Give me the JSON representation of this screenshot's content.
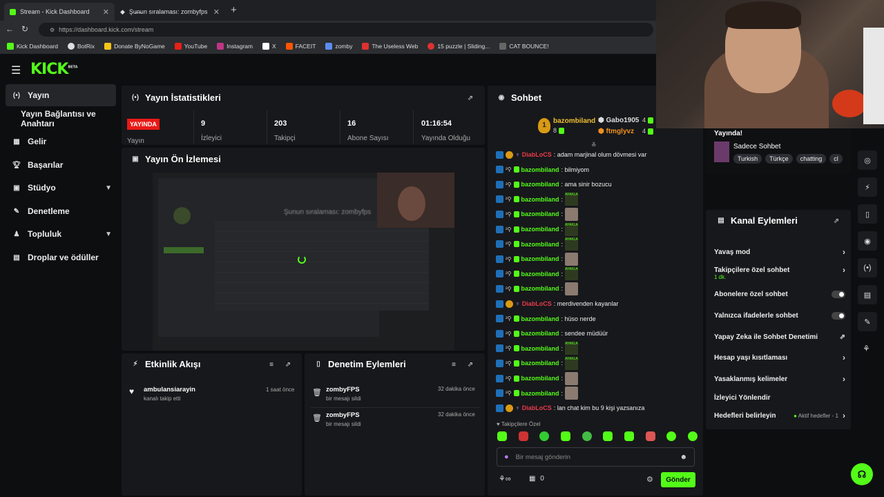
{
  "browser": {
    "tabs": [
      {
        "title": "Stream - Kick Dashboard"
      },
      {
        "title": "Şu̶n̶un sıralaması: zombyfps | Yayı"
      }
    ],
    "url": "https://dashboard.kick.com/stream",
    "bookmarks": [
      "Kick Dashboard",
      "BotRix",
      "Donate ByNoGame",
      "YouTube",
      "Instagram",
      "X",
      "FACEIT",
      "zomby",
      "The Useless Web",
      "15 puzzle | Sliding...",
      "CAT BOUNCE!"
    ]
  },
  "brand": {
    "logo": "KICK",
    "beta": "BETA"
  },
  "sidebar": {
    "items": [
      {
        "label": "Yayın",
        "icon": "broadcast-icon"
      },
      {
        "label": "Yayın Bağlantısı ve Anahtarı"
      },
      {
        "label": "Gelir",
        "icon": "revenue-icon"
      },
      {
        "label": "Başarılar",
        "icon": "trophy-icon"
      },
      {
        "label": "Stüdyo",
        "icon": "studio-icon"
      },
      {
        "label": "Denetleme",
        "icon": "wrench-icon"
      },
      {
        "label": "Topluluk",
        "icon": "community-icon"
      },
      {
        "label": "Droplar ve ödüller",
        "icon": "drops-icon"
      }
    ]
  },
  "stats": {
    "title": "Yayın İstatistikleri",
    "live": "YAYINDA",
    "live_label": "Yayın",
    "items": [
      {
        "value": "9",
        "label": "İzleyici"
      },
      {
        "value": "203",
        "label": "Takipçi"
      },
      {
        "value": "16",
        "label": "Abone Sayısı"
      },
      {
        "value": "01:16:54",
        "label": "Yayında Olduğu"
      }
    ]
  },
  "preview": {
    "title": "Yayın Ön İzlemesi",
    "inner_text": "Şunun sıralaması: zombyfps"
  },
  "activity": {
    "title": "Etkinlik Akışı",
    "items": [
      {
        "user": "ambulansiarayin",
        "action": "kanalı takip etti",
        "time": "1 saat önce"
      }
    ]
  },
  "moderation": {
    "title": "Denetim Eylemleri",
    "items": [
      {
        "user": "zombyFPS",
        "action": "bir mesajı sildi",
        "time": "32 dakika önce"
      },
      {
        "user": "zombyFPS",
        "action": "bir mesajı sildi",
        "time": "32 dakika önce"
      }
    ]
  },
  "chat": {
    "title": "Sohbet",
    "top": [
      {
        "name": "bazombiland",
        "count": "8"
      },
      {
        "name": "Gabo1905",
        "count": "4"
      },
      {
        "name": "ftmglyvz",
        "count": "4"
      }
    ],
    "messages": [
      {
        "user": "DiabLoCS",
        "text": ": adam marjinal olum dövmesi var",
        "red": true
      },
      {
        "user": "bazombiland",
        "text": ": bilmiyom"
      },
      {
        "user": "bazombiland",
        "text": ": ama sinir bozucu"
      },
      {
        "user": "bazombiland",
        "text": ":",
        "emote": "text"
      },
      {
        "user": "bazombiland",
        "text": ":",
        "emote": "img"
      },
      {
        "user": "bazombiland",
        "text": ":",
        "emote": "text"
      },
      {
        "user": "bazombiland",
        "text": ":",
        "emote": "text"
      },
      {
        "user": "bazombiland",
        "text": ":",
        "emote": "img"
      },
      {
        "user": "bazombiland",
        "text": ":",
        "emote": "text"
      },
      {
        "user": "bazombiland",
        "text": ":",
        "emote": "img"
      },
      {
        "user": "DiabLoCS",
        "text": ": merdivenden kayanlar",
        "red": true
      },
      {
        "user": "bazombiland",
        "text": ": hüso nerde"
      },
      {
        "user": "bazombiland",
        "text": ": sendee müdüür"
      },
      {
        "user": "bazombiland",
        "text": ":",
        "emote": "text"
      },
      {
        "user": "bazombiland",
        "text": ":",
        "emote": "text"
      },
      {
        "user": "bazombiland",
        "text": ":",
        "emote": "img"
      },
      {
        "user": "bazombiland",
        "text": ":",
        "emote": "img"
      },
      {
        "user": "DiabLoCS",
        "text": ": lan chat kim bu 9 kişi yazsanıza",
        "red": true
      }
    ],
    "emote_text": "AYAKLAN AAAAAA BASSAN",
    "followers_only": "Takipçilere Özel",
    "placeholder": "Bir mesaj gönderin",
    "points": "0",
    "send": "Gönder"
  },
  "right": {
    "live_text": "Yayında!",
    "category": "Sadece Sohbet",
    "tags": [
      "Turkish",
      "Türkçe",
      "chatting",
      "cl"
    ],
    "actions_title": "Kanal Eylemleri",
    "actions": [
      {
        "label": "Yavaş mod",
        "type": "chevron"
      },
      {
        "label": "Takipçilere özel sohbet",
        "sub": "1 dk.",
        "type": "chevron"
      },
      {
        "label": "Abonelere özel sohbet",
        "type": "toggle"
      },
      {
        "label": "Yalnızca ifadelerle sohbet",
        "type": "toggle"
      },
      {
        "label": "Yapay Zeka ile Sohbet Denetimi",
        "type": "external"
      },
      {
        "label": "Hesap yaşı kısıtlaması",
        "type": "chevron"
      },
      {
        "label": "Yasaklanmış kelimeler",
        "type": "chevron"
      },
      {
        "label": "İzleyici Yönlendir",
        "type": "none"
      },
      {
        "label": "Hedefleri belirleyin",
        "sub": "Aktif hedefler - 1",
        "type": "chevron"
      }
    ]
  },
  "colors": {
    "accent": "#53fc18",
    "live": "#e91916",
    "panel": "#17181b",
    "bg": "#0d0e10"
  }
}
